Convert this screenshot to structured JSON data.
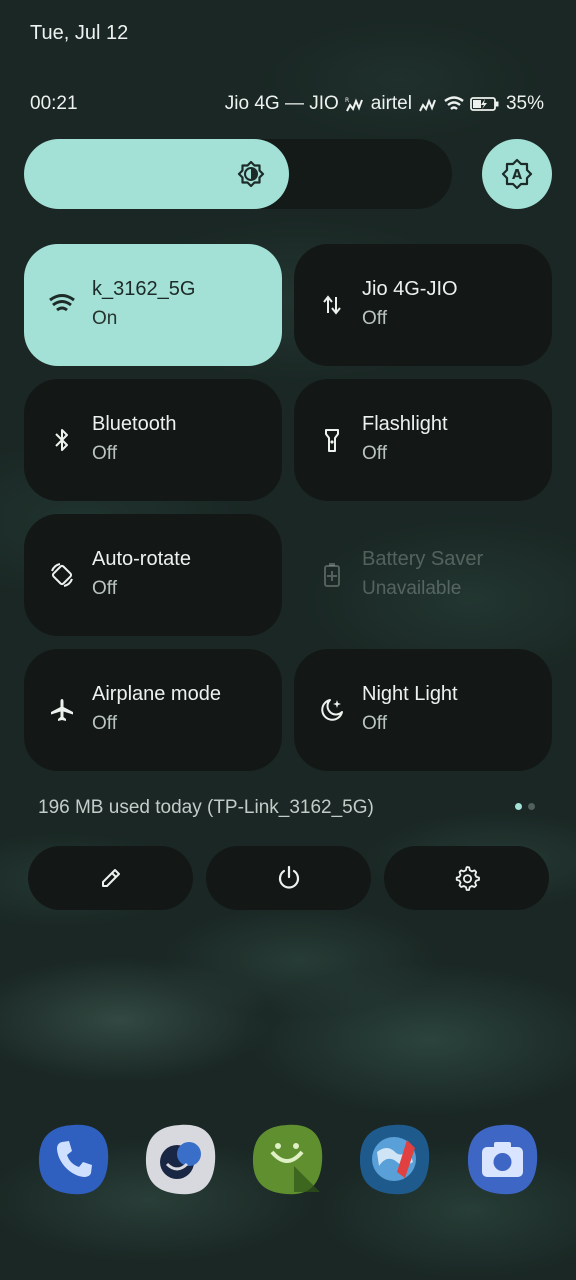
{
  "status": {
    "date": "Tue, Jul 12",
    "time": "00:21",
    "carriers": "Jio 4G — JIO",
    "carrier2": "airtel",
    "battery": "35%"
  },
  "brightness": {
    "level": 0.62,
    "accent": "#a3e0d6"
  },
  "tiles": [
    {
      "label": "k_3162_5G",
      "state": "On",
      "icon": "wifi-icon",
      "active": true
    },
    {
      "label": "Jio 4G-JIO",
      "state": "Off",
      "icon": "mobile-data-icon",
      "active": false
    },
    {
      "label": "Bluetooth",
      "state": "Off",
      "icon": "bluetooth-icon",
      "active": false
    },
    {
      "label": "Flashlight",
      "state": "Off",
      "icon": "flashlight-icon",
      "active": false
    },
    {
      "label": "Auto-rotate",
      "state": "Off",
      "icon": "auto-rotate-icon",
      "active": false
    },
    {
      "label": "Battery Saver",
      "state": "Unavailable",
      "icon": "battery-saver-icon",
      "active": false
    },
    {
      "label": "Airplane mode",
      "state": "Off",
      "icon": "airplane-icon",
      "active": false
    },
    {
      "label": "Night Light",
      "state": "Off",
      "icon": "night-light-icon",
      "active": false
    }
  ],
  "data_usage": "196 MB used today (TP-Link_3162_5G)",
  "actions": [
    {
      "icon": "edit-icon"
    },
    {
      "icon": "power-icon"
    },
    {
      "icon": "settings-icon"
    }
  ],
  "dock": [
    {
      "icon": "phone-app-icon",
      "color": "#2f5fbf"
    },
    {
      "icon": "messages-app-icon",
      "color": "#d7d9de"
    },
    {
      "icon": "hangouts-app-icon",
      "color": "#5f8f2f"
    },
    {
      "icon": "browser-app-icon",
      "color": "#2d6fa8"
    },
    {
      "icon": "camera-app-icon",
      "color": "#3e66c4"
    }
  ]
}
